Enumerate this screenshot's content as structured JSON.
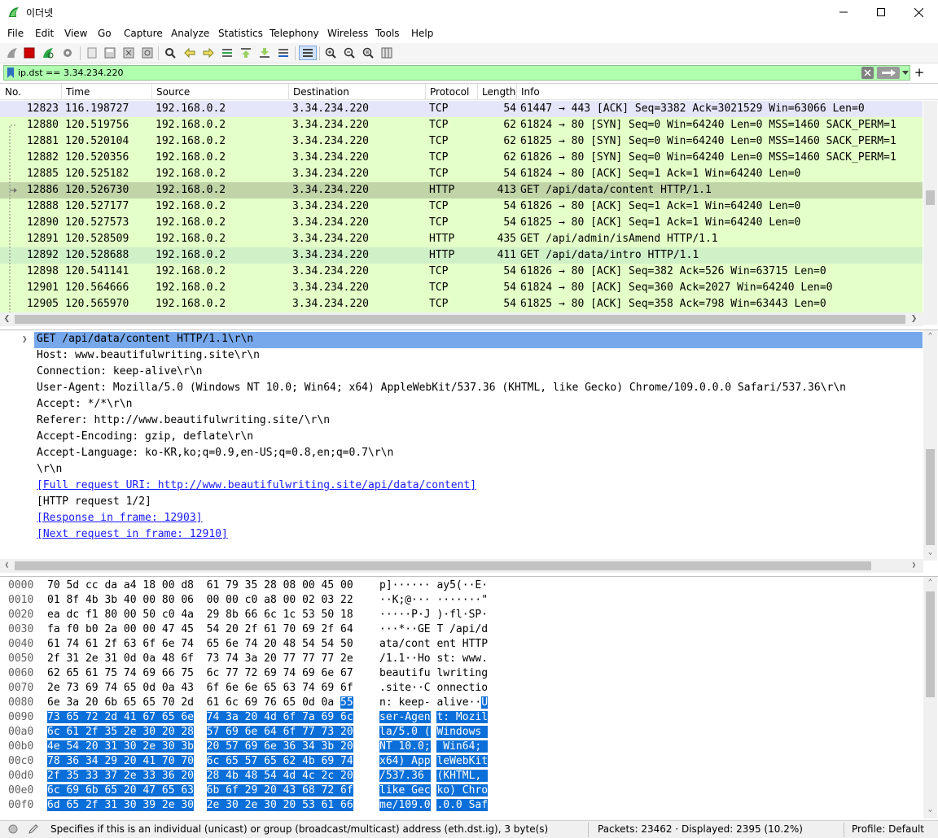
{
  "window": {
    "title": "이더넷"
  },
  "menu": [
    "File",
    "Edit",
    "View",
    "Go",
    "Capture",
    "Analyze",
    "Statistics",
    "Telephony",
    "Wireless",
    "Tools",
    "Help"
  ],
  "filter": {
    "value": "ip.dst == 3.34.234.220"
  },
  "packet_list": {
    "columns": [
      "No.",
      "Time",
      "Source",
      "Destination",
      "Protocol",
      "Length",
      "Info"
    ],
    "rows": [
      {
        "no": "12823",
        "time": "116.198727",
        "src": "192.168.0.2",
        "dst": "3.34.234.220",
        "proto": "TCP",
        "len": "54",
        "info": "61447 → 443 [ACK] Seq=3382 Ack=3021529 Win=63066 Len=0",
        "bg": "#e6e6fa"
      },
      {
        "no": "12880",
        "time": "120.519756",
        "src": "192.168.0.2",
        "dst": "3.34.234.220",
        "proto": "TCP",
        "len": "62",
        "info": "61824 → 80 [SYN] Seq=0 Win=64240 Len=0 MSS=1460 SACK_PERM=1",
        "bg": "#e4ffc7"
      },
      {
        "no": "12881",
        "time": "120.520104",
        "src": "192.168.0.2",
        "dst": "3.34.234.220",
        "proto": "TCP",
        "len": "62",
        "info": "61825 → 80 [SYN] Seq=0 Win=64240 Len=0 MSS=1460 SACK_PERM=1",
        "bg": "#e4ffc7"
      },
      {
        "no": "12882",
        "time": "120.520356",
        "src": "192.168.0.2",
        "dst": "3.34.234.220",
        "proto": "TCP",
        "len": "62",
        "info": "61826 → 80 [SYN] Seq=0 Win=64240 Len=0 MSS=1460 SACK_PERM=1",
        "bg": "#e4ffc7"
      },
      {
        "no": "12885",
        "time": "120.525182",
        "src": "192.168.0.2",
        "dst": "3.34.234.220",
        "proto": "TCP",
        "len": "54",
        "info": "61824 → 80 [ACK] Seq=1 Ack=1 Win=64240 Len=0",
        "bg": "#e4ffc7"
      },
      {
        "no": "12886",
        "time": "120.526730",
        "src": "192.168.0.2",
        "dst": "3.34.234.220",
        "proto": "HTTP",
        "len": "413",
        "info": "GET /api/data/content HTTP/1.1",
        "bg": "#c0d4a8"
      },
      {
        "no": "12888",
        "time": "120.527177",
        "src": "192.168.0.2",
        "dst": "3.34.234.220",
        "proto": "TCP",
        "len": "54",
        "info": "61826 → 80 [ACK] Seq=1 Ack=1 Win=64240 Len=0",
        "bg": "#e4ffc7"
      },
      {
        "no": "12890",
        "time": "120.527573",
        "src": "192.168.0.2",
        "dst": "3.34.234.220",
        "proto": "TCP",
        "len": "54",
        "info": "61825 → 80 [ACK] Seq=1 Ack=1 Win=64240 Len=0",
        "bg": "#e4ffc7"
      },
      {
        "no": "12891",
        "time": "120.528509",
        "src": "192.168.0.2",
        "dst": "3.34.234.220",
        "proto": "HTTP",
        "len": "435",
        "info": "GET /api/admin/isAmend HTTP/1.1",
        "bg": "#e4ffc7"
      },
      {
        "no": "12892",
        "time": "120.528688",
        "src": "192.168.0.2",
        "dst": "3.34.234.220",
        "proto": "HTTP",
        "len": "411",
        "info": "GET /api/data/intro HTTP/1.1",
        "bg": "#d0f0c8"
      },
      {
        "no": "12898",
        "time": "120.541141",
        "src": "192.168.0.2",
        "dst": "3.34.234.220",
        "proto": "TCP",
        "len": "54",
        "info": "61826 → 80 [ACK] Seq=382 Ack=526 Win=63715 Len=0",
        "bg": "#e4ffc7"
      },
      {
        "no": "12901",
        "time": "120.564666",
        "src": "192.168.0.2",
        "dst": "3.34.234.220",
        "proto": "TCP",
        "len": "54",
        "info": "61824 → 80 [ACK] Seq=360 Ack=2027 Win=64240 Len=0",
        "bg": "#e4ffc7"
      },
      {
        "no": "12905",
        "time": "120.565970",
        "src": "192.168.0.2",
        "dst": "3.34.234.220",
        "proto": "TCP",
        "len": "54",
        "info": "61825 → 80 [ACK] Seq=358 Ack=798 Win=63443 Len=0",
        "bg": "#e4ffc7"
      }
    ]
  },
  "details": {
    "selected": "GET /api/data/content HTTP/1.1\\r\\n",
    "lines": [
      {
        "text": "Host: www.beautifulwriting.site\\r\\n",
        "link": false
      },
      {
        "text": "Connection: keep-alive\\r\\n",
        "link": false
      },
      {
        "text": "User-Agent: Mozilla/5.0 (Windows NT 10.0; Win64; x64) AppleWebKit/537.36 (KHTML, like Gecko) Chrome/109.0.0.0 Safari/537.36\\r\\n",
        "link": false
      },
      {
        "text": "Accept: */*\\r\\n",
        "link": false
      },
      {
        "text": "Referer: http://www.beautifulwriting.site/\\r\\n",
        "link": false
      },
      {
        "text": "Accept-Encoding: gzip, deflate\\r\\n",
        "link": false
      },
      {
        "text": "Accept-Language: ko-KR,ko;q=0.9,en-US;q=0.8,en;q=0.7\\r\\n",
        "link": false
      },
      {
        "text": "\\r\\n",
        "link": false
      },
      {
        "text": "[Full request URI: http://www.beautifulwriting.site/api/data/content]",
        "link": true
      },
      {
        "text": "[HTTP request 1/2]",
        "link": false
      },
      {
        "text": "[Response in frame: 12903]",
        "link": true
      },
      {
        "text": "[Next request in frame: 12910]",
        "link": true
      }
    ]
  },
  "bytes": [
    {
      "off": "0000",
      "hex1": "70 5d cc da a4 18 00 d8",
      "hex2": "61 79 35 28 08 00 45 00",
      "asc1": "p]······",
      "asc2": "ay5(··E·"
    },
    {
      "off": "0010",
      "hex1": "01 8f 4b 3b 40 00 80 06",
      "hex2": "00 00 c0 a8 00 02 03 22",
      "asc1": "··K;@···",
      "asc2": "·······\""
    },
    {
      "off": "0020",
      "hex1": "ea dc f1 80 00 50 c0 4a",
      "hex2": "29 8b 66 6c 1c 53 50 18",
      "asc1": "·····P·J",
      "asc2": ")·fl·SP·"
    },
    {
      "off": "0030",
      "hex1": "fa f0 b0 2a 00 00 47 45",
      "hex2": "54 20 2f 61 70 69 2f 64",
      "asc1": "···*··GE",
      "asc2": "T /api/d"
    },
    {
      "off": "0040",
      "hex1": "61 74 61 2f 63 6f 6e 74",
      "hex2": "65 6e 74 20 48 54 54 50",
      "asc1": "ata/cont",
      "asc2": "ent HTTP"
    },
    {
      "off": "0050",
      "hex1": "2f 31 2e 31 0d 0a 48 6f",
      "hex2": "73 74 3a 20 77 77 77 2e",
      "asc1": "/1.1··Ho",
      "asc2": "st: www."
    },
    {
      "off": "0060",
      "hex1": "62 65 61 75 74 69 66 75",
      "hex2": "6c 77 72 69 74 69 6e 67",
      "asc1": "beautifu",
      "asc2": "lwriting"
    },
    {
      "off": "0070",
      "hex1": "2e 73 69 74 65 0d 0a 43",
      "hex2": "6f 6e 6e 65 63 74 69 6f",
      "asc1": ".site··C",
      "asc2": "onnectio"
    },
    {
      "off": "0080",
      "hex1": "6e 3a 20 6b 65 65 70 2d",
      "hex2": "61 6c 69 76 65 0d 0a 55",
      "asc1": "n: keep-",
      "asc2": "alive··U"
    },
    {
      "off": "0090",
      "hex1": "73 65 72 2d 41 67 65 6e",
      "hex2": "74 3a 20 4d 6f 7a 69 6c",
      "asc1": "ser-Agen",
      "asc2": "t: Mozil"
    },
    {
      "off": "00a0",
      "hex1": "6c 61 2f 35 2e 30 20 28",
      "hex2": "57 69 6e 64 6f 77 73 20",
      "asc1": "la/5.0 (",
      "asc2": "Windows "
    },
    {
      "off": "00b0",
      "hex1": "4e 54 20 31 30 2e 30 3b",
      "hex2": "20 57 69 6e 36 34 3b 20",
      "asc1": "NT 10.0;",
      "asc2": " Win64; "
    },
    {
      "off": "00c0",
      "hex1": "78 36 34 29 20 41 70 70",
      "hex2": "6c 65 57 65 62 4b 69 74",
      "asc1": "x64) App",
      "asc2": "leWebKit"
    },
    {
      "off": "00d0",
      "hex1": "2f 35 33 37 2e 33 36 20",
      "hex2": "28 4b 48 54 4d 4c 2c 20",
      "asc1": "/537.36 ",
      "asc2": "(KHTML, "
    },
    {
      "off": "00e0",
      "hex1": "6c 69 6b 65 20 47 65 63",
      "hex2": "6b 6f 29 20 43 68 72 6f",
      "asc1": "like Gec",
      "asc2": "ko) Chro"
    },
    {
      "off": "00f0",
      "hex1": "6d 65 2f 31 30 39 2e 30",
      "hex2": "2e 30 2e 30 20 53 61 66",
      "asc1": "me/109.0",
      "asc2": ".0.0 Saf"
    }
  ],
  "status": {
    "message": "Specifies if this is an individual (unicast) or group (broadcast/multicast) address (eth.dst.ig), 3 byte(s)",
    "packets": "Packets: 23462 · Displayed: 2395 (10.2%)",
    "profile": "Profile: Default"
  },
  "colors": {
    "tcp_row": "#e4ffc7",
    "selected_row": "#c0d4a8",
    "filter_bg": "#afffaf",
    "hex_highlight": "#0a6fd8"
  }
}
